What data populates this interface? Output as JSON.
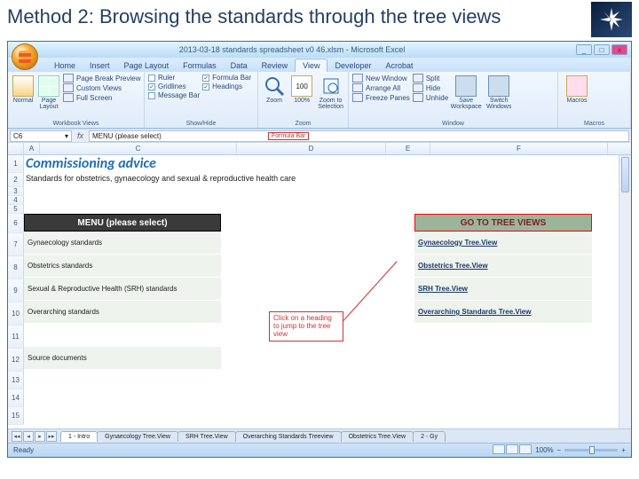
{
  "slide": {
    "title": "Method 2: Browsing the standards through the tree views"
  },
  "window": {
    "doc_title": "2013-03-18 standards spreadsheet v0 46.xlsm - Microsoft Excel",
    "min": "_",
    "max": "□",
    "close": "x"
  },
  "tabs": {
    "items": [
      "Home",
      "Insert",
      "Page Layout",
      "Formulas",
      "Data",
      "Review",
      "View",
      "Developer",
      "Acrobat"
    ],
    "active_index": 6
  },
  "ribbon": {
    "wbviews": {
      "label": "Workbook Views",
      "normal": "Normal",
      "page_layout": "Page Layout",
      "page_break": "Page Break Preview",
      "custom": "Custom Views",
      "full": "Full Screen"
    },
    "showhide": {
      "label": "Show/Hide",
      "ruler": "Ruler",
      "gridlines": "Gridlines",
      "msgbar": "Message Bar",
      "formulabar": "Formula Bar",
      "headings": "Headings"
    },
    "zoom": {
      "label": "Zoom",
      "zoom": "Zoom",
      "hundred": "100%",
      "to_sel": "Zoom to Selection"
    },
    "window_grp": {
      "label": "Window",
      "new": "New Window",
      "arrange": "Arrange All",
      "freeze": "Freeze Panes",
      "split": "Split",
      "hide": "Hide",
      "unhide": "Unhide",
      "save_ws": "Save Workspace",
      "switch": "Switch Windows"
    },
    "macros": {
      "label": "Macros",
      "macros": "Macros"
    }
  },
  "namebox": {
    "ref": "C6",
    "formula": "MENU (please select)",
    "tag": "Formula Bar"
  },
  "columns": [
    "",
    "A",
    "C",
    "D",
    "E",
    "F"
  ],
  "rows": [
    "1",
    "2",
    "3",
    "4",
    "5",
    "6",
    "7",
    "8",
    "9",
    "10",
    "11",
    "12",
    "13",
    "14",
    "15"
  ],
  "sheet": {
    "title": "Commissioning advice",
    "subtitle": "Standards for obstetrics, gynaecology and sexual & reproductive health care",
    "menu_header": "MENU (please select)",
    "tree_header": "GO TO TREE VIEWS",
    "menu_items": [
      "Gynaecology standards",
      "Obstetrics standards",
      "Sexual & Reproductive Health (SRH) standards",
      "Overarching standards",
      "",
      "Source documents"
    ],
    "tree_items": [
      "Gynaecology Tree.View",
      "Obstetrics Tree.View",
      "SRH Tree.View",
      "Overarching Standards Tree.View"
    ],
    "callout": "Click on a heading to jump to the tree view"
  },
  "sheet_tabs": [
    "1 - Intro",
    "Gynaecology Tree.View",
    "SRH Tree.View",
    "Overarching Standards Treeview",
    "Obstetrics Tree.View",
    "2 - Gy"
  ],
  "status": {
    "ready": "Ready",
    "zoom": "100%",
    "minus": "−",
    "plus": "+"
  }
}
